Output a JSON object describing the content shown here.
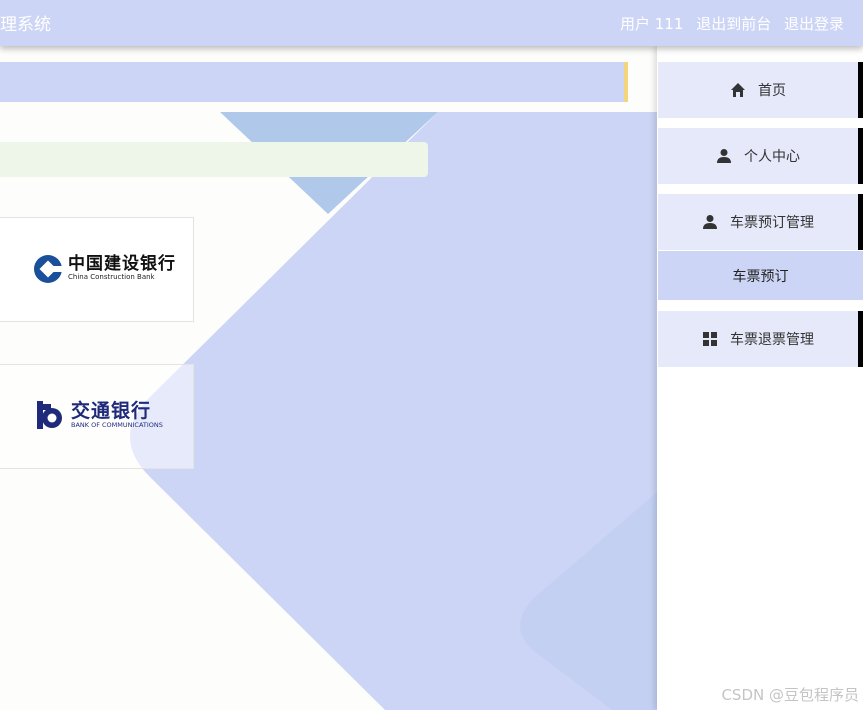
{
  "header": {
    "app_title": "理系统",
    "user_label": "用户 111",
    "back_frontend": "退出到前台",
    "logout": "退出登录"
  },
  "banks": [
    {
      "name_cn": "中国建设银行",
      "name_en": "China Construction Bank",
      "logo_color": "#1a4f9c"
    },
    {
      "name_cn": "交通银行",
      "name_en": "BANK OF COMMUNICATIONS",
      "logo_color": "#1f2a7a"
    }
  ],
  "sidebar": {
    "items": [
      {
        "label": "首页",
        "icon": "home-icon"
      },
      {
        "label": "个人中心",
        "icon": "user-icon"
      },
      {
        "label": "车票预订管理",
        "icon": "user-icon"
      },
      {
        "label": "车票退票管理",
        "icon": "grid-icon"
      }
    ],
    "submenu": {
      "label": "车票预订"
    }
  },
  "watermark": "CSDN @豆包程序员",
  "colors": {
    "header_bg": "#cdd5f6",
    "menu_bg": "#e5e9f9",
    "active_sub_bg": "#cdd5f6",
    "accent_border": "#f4d47c",
    "notice_bg": "#edf6e8"
  }
}
